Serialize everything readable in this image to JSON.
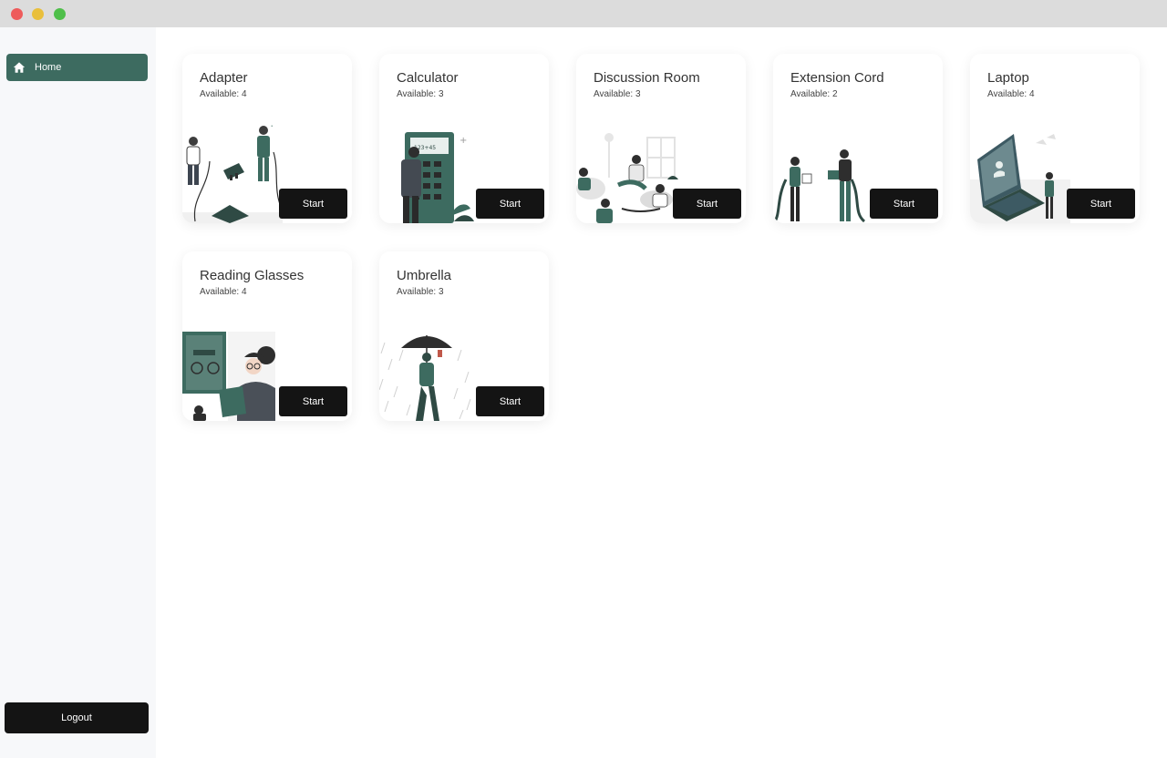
{
  "sidebar": {
    "home_label": "Home",
    "logout_label": "Logout"
  },
  "colors": {
    "accent": "#3d6b60",
    "button": "#141414"
  },
  "items": [
    {
      "title": "Adapter",
      "available": "Available: 4",
      "start_label": "Start"
    },
    {
      "title": "Calculator",
      "available": "Available: 3",
      "start_label": "Start"
    },
    {
      "title": "Discussion Room",
      "available": "Available: 3",
      "start_label": "Start"
    },
    {
      "title": "Extension Cord",
      "available": "Available: 2",
      "start_label": "Start"
    },
    {
      "title": "Laptop",
      "available": "Available: 4",
      "start_label": "Start"
    },
    {
      "title": "Reading Glasses",
      "available": "Available: 4",
      "start_label": "Start"
    },
    {
      "title": "Umbrella",
      "available": "Available: 3",
      "start_label": "Start"
    }
  ]
}
